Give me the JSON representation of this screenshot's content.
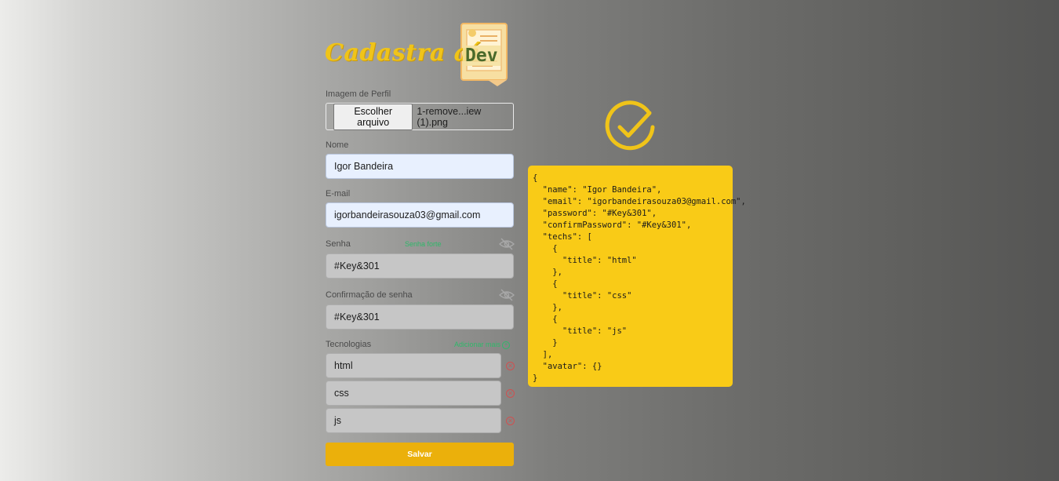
{
  "brand": {
    "title": "Cadastra aí",
    "badge": "Dev"
  },
  "form": {
    "avatar": {
      "label": "Imagem de Perfil",
      "button": "Escolher arquivo",
      "filename": "1-remove...iew (1).png"
    },
    "name": {
      "label": "Nome",
      "value": "Igor Bandeira"
    },
    "email": {
      "label": "E-mail",
      "value": "igorbandeirasouza03@gmail.com"
    },
    "password": {
      "label": "Senha",
      "strength": "Senha forte",
      "value": "#Key&301"
    },
    "confirm": {
      "label": "Confirmação de senha",
      "value": "#Key&301"
    },
    "techs": {
      "label": "Tecnologias",
      "add_label": "Adicionar mais",
      "items": [
        {
          "value": "html"
        },
        {
          "value": "css"
        },
        {
          "value": "js"
        }
      ]
    },
    "submit": "Salvar"
  },
  "result": {
    "json": "{\n  \"name\": \"Igor Bandeira\",\n  \"email\": \"igorbandeirasouza03@gmail.com\",\n  \"password\": \"#Key&301\",\n  \"confirmPassword\": \"#Key&301\",\n  \"techs\": [\n    {\n      \"title\": \"html\"\n    },\n    {\n      \"title\": \"css\"\n    },\n    {\n      \"title\": \"js\"\n    }\n  ],\n  \"avatar\": {}\n}"
  },
  "icons": {
    "password_toggle": "eye-slash-icon",
    "confirm_toggle": "eye-slash-icon",
    "add": "plus-circle-icon",
    "remove": "close-circle-icon",
    "success": "check-circle-icon",
    "logo": "clipboard-icon"
  },
  "colors": {
    "accent": "#f9cb17",
    "button": "#ebb00b",
    "strong": "#2fb86a",
    "danger": "#d05050"
  }
}
